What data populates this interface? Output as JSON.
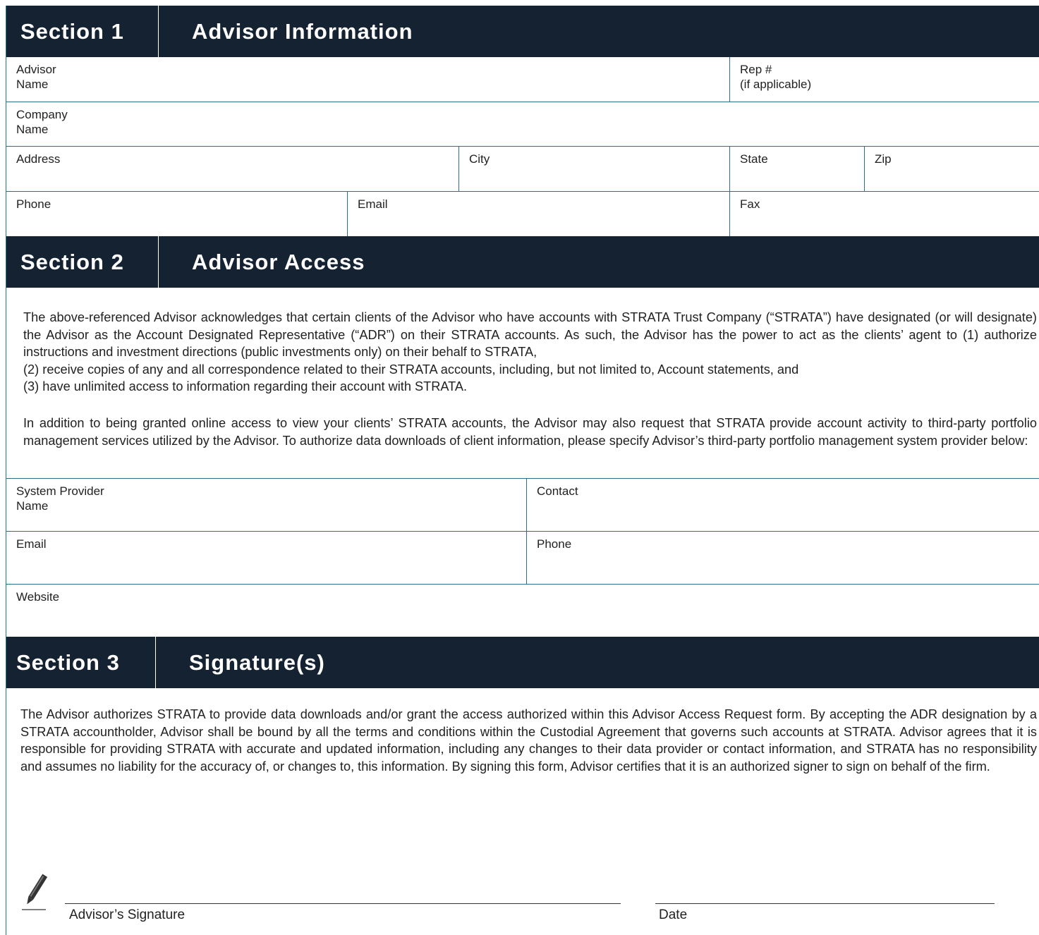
{
  "section1": {
    "number": "Section 1",
    "title": "Advisor Information",
    "fields": {
      "advisor_name": "Advisor\nName",
      "rep": "Rep #\n(if applicable)",
      "company_name": "Company\nName",
      "address": "Address",
      "city": "City",
      "state": "State",
      "zip": "Zip",
      "phone": "Phone",
      "email": "Email",
      "fax": "Fax"
    }
  },
  "section2": {
    "number": "Section 2",
    "title": "Advisor Access",
    "paragraph1": "The above-referenced Advisor acknowledges that certain clients of the Advisor who have accounts with STRATA Trust Company (“STRATA”) have designated (or will designate) the Advisor as the Account Designated Representative (“ADR”) on their STRATA accounts. As such, the Advisor has the power to act as the clients’ agent to (1) authorize instructions and investment directions (public investments only) on their behalf to STRATA,",
    "paragraph1_item2": "(2) receive copies of any and all correspondence related to their STRATA accounts, including, but not limited to, Account statements, and",
    "paragraph1_item3": "(3) have unlimited access to information regarding their account with STRATA.",
    "paragraph2": "In addition to being granted online access to view your clients’ STRATA accounts, the Advisor may also request that STRATA provide account activity to third-party portfolio management services utilized by the Advisor. To authorize data downloads of client information, please specify Advisor’s third-party portfolio management system provider below:",
    "fields": {
      "system_provider_name": "System Provider\nName",
      "contact": "Contact",
      "email": "Email",
      "phone": "Phone",
      "website": "Website"
    }
  },
  "section3": {
    "number": "Section 3",
    "title": "Signature(s)",
    "paragraph": "The Advisor authorizes STRATA to provide data downloads and/or grant the access authorized within this Advisor Access Request form. By accepting the ADR designation by a STRATA accountholder, Advisor shall be bound by all the terms and conditions within the Custodial Agreement that governs such accounts at STRATA. Advisor agrees that it is responsible for providing STRATA with accurate and updated information, including any changes to their data provider or contact information, and STRATA has no responsibility and assumes no liability for the accuracy of, or changes to, this information. By signing this form, Advisor certifies that it is an authorized signer to sign on behalf of the firm.",
    "signature_label": "Advisor’s Signature",
    "date_label": "Date",
    "pen_icon": "pen-icon"
  },
  "colors": {
    "header_bg": "#142232",
    "rule": "#2d6f86"
  }
}
